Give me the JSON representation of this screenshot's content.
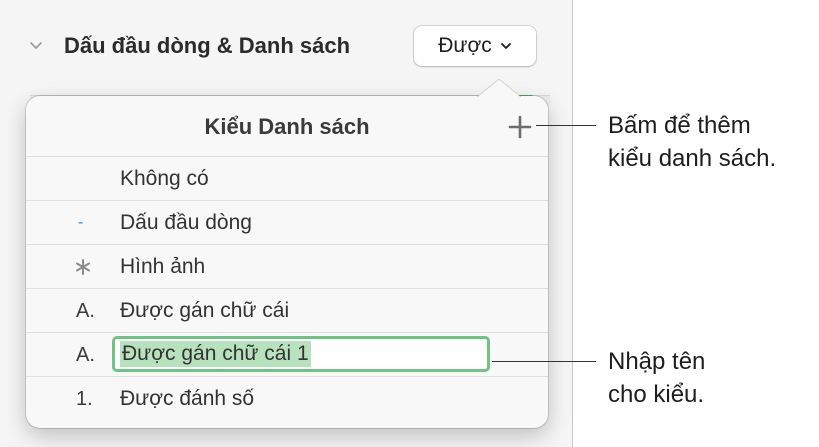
{
  "section": {
    "title": "Dấu đầu dòng & Danh sách",
    "style_select_value": "Được"
  },
  "popover": {
    "title": "Kiểu Danh sách",
    "items": [
      {
        "marker": "",
        "label": "Không có"
      },
      {
        "marker": "-",
        "label": "Dấu đầu dòng"
      },
      {
        "marker": "",
        "label": "Hình ảnh"
      },
      {
        "marker": "A.",
        "label": "Được gán chữ cái"
      },
      {
        "marker": "A.",
        "label": "Được gán chữ cái 1"
      },
      {
        "marker": "1.",
        "label": "Được đánh số"
      }
    ],
    "editing_index": 4
  },
  "callouts": {
    "add_style": [
      "Bấm để thêm",
      "kiểu danh sách."
    ],
    "name_style": [
      "Nhập tên",
      "cho kiểu."
    ]
  },
  "colors": {
    "edit_border": "#6ec483",
    "edit_selection": "#b7e2bd",
    "bullet_dash": "#3a8bd8"
  },
  "icons": {
    "section_toggle": "chevron-down-icon",
    "select_arrow": "chevron-down-icon",
    "add": "plus-icon",
    "image_bullet": "asterisk-icon"
  }
}
